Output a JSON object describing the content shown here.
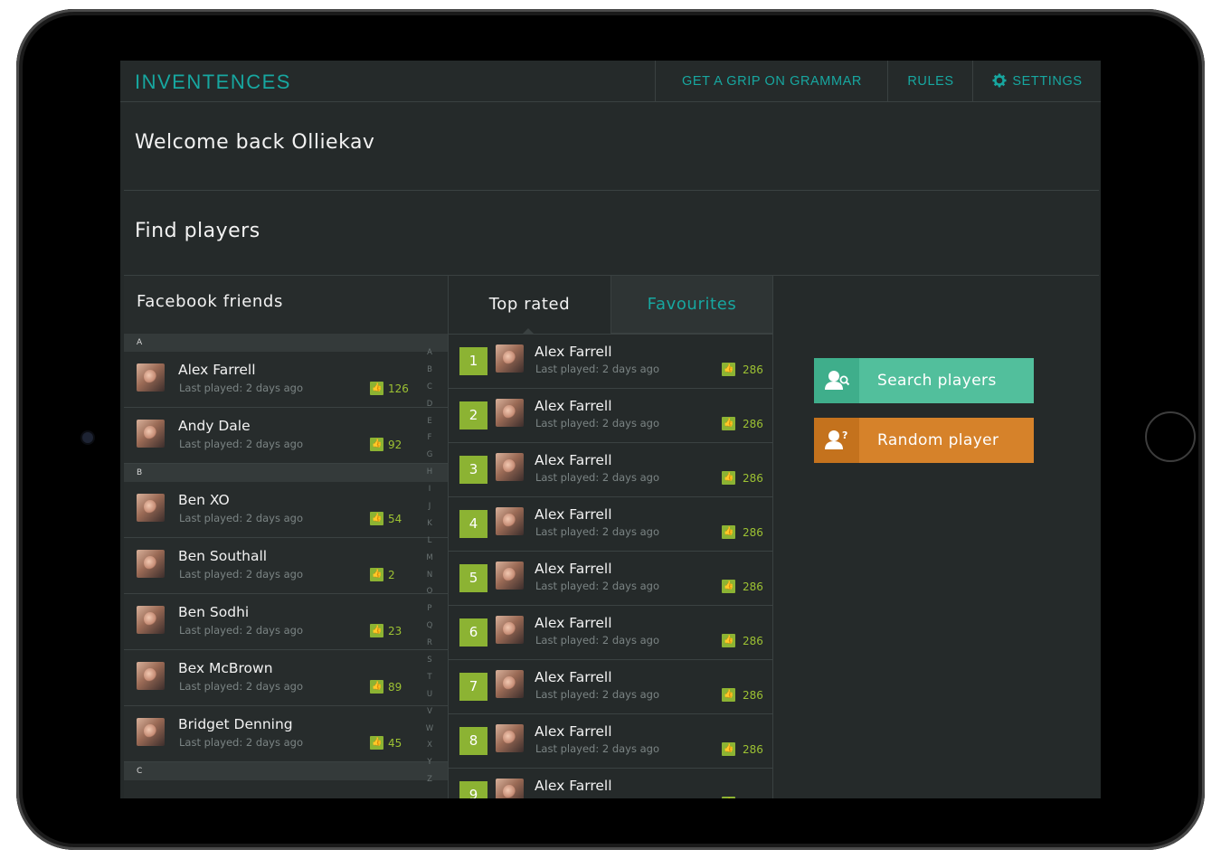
{
  "header": {
    "logo": "INVENTENCES",
    "nav": [
      {
        "label": "GET A GRIP ON GRAMMAR"
      },
      {
        "label": "RULES"
      },
      {
        "label": "SETTINGS",
        "icon": "gear-icon"
      }
    ]
  },
  "welcome": "Welcome back Olliekav",
  "find_players": "Find players",
  "facebook": {
    "title": "Facebook friends",
    "sections": [
      {
        "letter": "A",
        "players": [
          {
            "name": "Alex Farrell",
            "last": "Last played: 2 days ago",
            "score": "126"
          },
          {
            "name": "Andy Dale",
            "last": "Last played: 2 days ago",
            "score": "92"
          }
        ]
      },
      {
        "letter": "B",
        "players": [
          {
            "name": "Ben XO",
            "last": "Last played: 2 days ago",
            "score": "54"
          },
          {
            "name": "Ben Southall",
            "last": "Last played: 2 days ago",
            "score": "2"
          },
          {
            "name": "Ben Sodhi",
            "last": "Last played: 2 days ago",
            "score": "23"
          },
          {
            "name": "Bex McBrown",
            "last": "Last played: 2 days ago",
            "score": "89"
          },
          {
            "name": "Bridget Denning",
            "last": "Last played: 2 days ago",
            "score": "45"
          }
        ]
      },
      {
        "letter": "C",
        "players": []
      }
    ],
    "alphabet": [
      "A",
      "B",
      "C",
      "D",
      "E",
      "F",
      "G",
      "H",
      "I",
      "J",
      "K",
      "L",
      "M",
      "N",
      "O",
      "P",
      "Q",
      "R",
      "S",
      "T",
      "U",
      "V",
      "W",
      "X",
      "Y",
      "Z"
    ]
  },
  "tabs": {
    "top_rated": "Top rated",
    "favourites": "Favourites",
    "active": "Top rated"
  },
  "top_rated": [
    {
      "rank": "1",
      "name": "Alex Farrell",
      "last": "Last played: 2 days ago",
      "score": "286"
    },
    {
      "rank": "2",
      "name": "Alex Farrell",
      "last": "Last played: 2 days ago",
      "score": "286"
    },
    {
      "rank": "3",
      "name": "Alex Farrell",
      "last": "Last played: 2 days ago",
      "score": "286"
    },
    {
      "rank": "4",
      "name": "Alex Farrell",
      "last": "Last played: 2 days ago",
      "score": "286"
    },
    {
      "rank": "5",
      "name": "Alex Farrell",
      "last": "Last played: 2 days ago",
      "score": "286"
    },
    {
      "rank": "6",
      "name": "Alex Farrell",
      "last": "Last played: 2 days ago",
      "score": "286"
    },
    {
      "rank": "7",
      "name": "Alex Farrell",
      "last": "Last played: 2 days ago",
      "score": "286"
    },
    {
      "rank": "8",
      "name": "Alex Farrell",
      "last": "Last played: 2 days ago",
      "score": "286"
    },
    {
      "rank": "9",
      "name": "Alex Farrell",
      "last": "",
      "score": ""
    }
  ],
  "actions": {
    "search": {
      "label": "Search players",
      "icon": "user-search-icon",
      "color": "#52bf9c"
    },
    "random": {
      "label": "Random player",
      "icon": "user-question-icon",
      "color": "#d6822a"
    }
  },
  "colors": {
    "accent": "#17a7a0",
    "background": "#252a2a",
    "rank_badge": "#8cb333"
  }
}
